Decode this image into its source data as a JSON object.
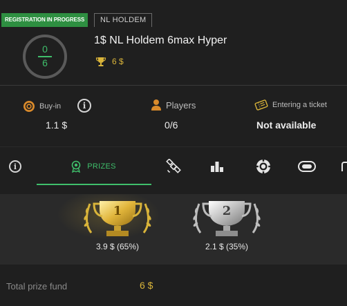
{
  "header": {
    "status_badge": "REGISTRATION IN PROGRESS",
    "game_type": "NL HOLDEM",
    "registered": "0",
    "max_players": "6",
    "title": "1$ NL Holdem 6max Hyper",
    "prize": "6 $"
  },
  "stats": {
    "buyin": {
      "label": "Buy-in",
      "value": "1.1 $"
    },
    "players": {
      "label": "Players",
      "value": "0/6"
    },
    "ticket": {
      "label": "Entering a ticket",
      "value": "Not available"
    }
  },
  "tabs": [
    {
      "icon": "info-icon"
    },
    {
      "icon": "award-icon",
      "label": "PRIZES",
      "active": true
    },
    {
      "icon": "satellite-icon"
    },
    {
      "icon": "podium-icon"
    },
    {
      "icon": "poker-chip-icon"
    },
    {
      "icon": "toggle-icon"
    }
  ],
  "prizes": [
    {
      "place": "1",
      "amount": "3.9 $ (65%)",
      "color": "#d9b43a"
    },
    {
      "place": "2",
      "amount": "2.1 $ (35%)",
      "color": "#c9c9c9"
    }
  ],
  "fund": {
    "label": "Total prize fund",
    "value": "6 $"
  },
  "colors": {
    "accent": "#3fbf6b",
    "gold": "#d9b43a",
    "background": "#1f1f1f"
  }
}
